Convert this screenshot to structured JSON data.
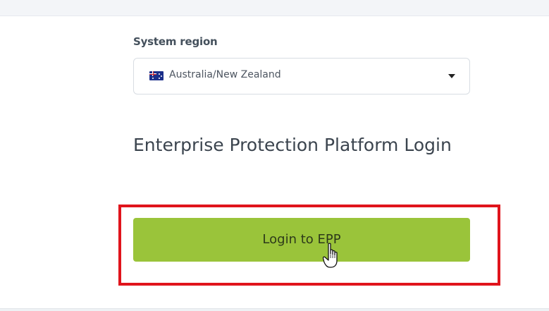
{
  "region": {
    "label": "System region",
    "selected_value": "Australia/New Zealand",
    "flag_icon": "australia-flag-icon"
  },
  "login": {
    "title": "Enterprise Protection Platform Login",
    "button_label": "Login to EPP"
  },
  "colors": {
    "button_bg": "#9ac43a",
    "highlight": "#e0141c",
    "text": "#3b444e"
  }
}
